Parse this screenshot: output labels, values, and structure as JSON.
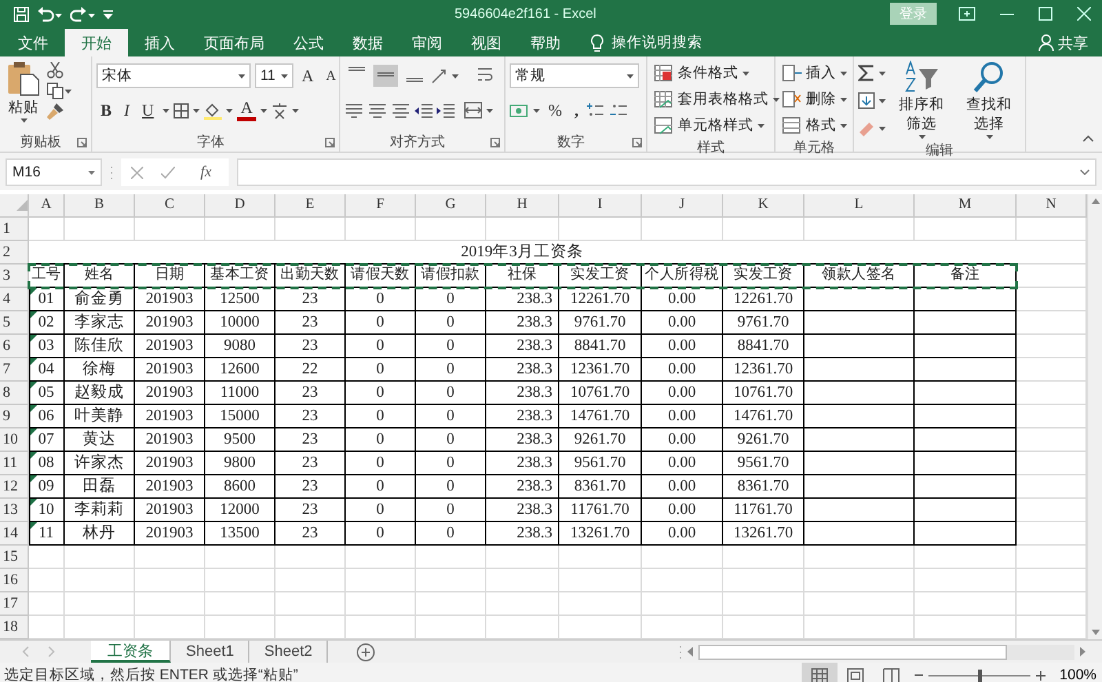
{
  "title_bar": {
    "title": "5946604e2f161  -  Excel",
    "sign_in": "登录"
  },
  "ribbon_tabs": [
    {
      "label": "文件",
      "selected": false
    },
    {
      "label": "开始",
      "selected": true
    },
    {
      "label": "插入",
      "selected": false
    },
    {
      "label": "页面布局",
      "selected": false
    },
    {
      "label": "公式",
      "selected": false
    },
    {
      "label": "数据",
      "selected": false
    },
    {
      "label": "审阅",
      "selected": false
    },
    {
      "label": "视图",
      "selected": false
    },
    {
      "label": "帮助",
      "selected": false
    }
  ],
  "tell_me": "操作说明搜索",
  "share": "共享",
  "ribbon": {
    "clipboard": {
      "paste": "粘贴",
      "label": "剪贴板"
    },
    "font": {
      "font_name": "宋体",
      "font_size": "11",
      "grow": "A",
      "shrink": "A",
      "bold": "B",
      "italic": "I",
      "underline": "U",
      "font_color": "A",
      "label": "字体"
    },
    "alignment": {
      "vertical": [
        {
          "kind": "top",
          "selected": false
        },
        {
          "kind": "middle",
          "selected": true
        },
        {
          "kind": "bottom",
          "selected": false
        }
      ],
      "label": "对齐方式"
    },
    "number": {
      "format": "常规",
      "percent": "%",
      "comma": ",",
      "label": "数字"
    },
    "styles": {
      "items": [
        "条件格式",
        "套用表格格式",
        "单元格样式"
      ],
      "label": "样式"
    },
    "cells": {
      "items": [
        "插入",
        "删除",
        "格式"
      ],
      "label": "单元格"
    },
    "editing": {
      "items": [
        "排序和筛选",
        "查找和选择"
      ],
      "label": "编辑"
    }
  },
  "formula_bar": {
    "name_box": "M16",
    "function_button": "fx"
  },
  "sheet": {
    "columns": [
      "A",
      "B",
      "C",
      "D",
      "E",
      "F",
      "G",
      "H",
      "I",
      "J",
      "K",
      "L",
      "M",
      "N"
    ],
    "row_numbers": [
      "1",
      "2",
      "3",
      "4",
      "5",
      "6",
      "7",
      "8",
      "9",
      "10",
      "11",
      "12",
      "13",
      "14",
      "15",
      "16",
      "17",
      "18"
    ],
    "title": "2019年3月工资条",
    "header": [
      "工号",
      "姓名",
      "日期",
      "基本工资",
      "出勤天数",
      "请假天数",
      "请假扣款",
      "社保",
      "实发工资",
      "个人所得税",
      "实发工资",
      "领款人签名",
      "备注"
    ],
    "header_marquee": true,
    "rows": [
      {
        "cells": [
          "01",
          "俞金勇",
          "201903",
          "12500",
          "23",
          "0",
          "0",
          "238.3",
          "12261.70",
          "0.00",
          "12261.70"
        ],
        "flagged": true
      },
      {
        "cells": [
          "02",
          "李家志",
          "201903",
          "10000",
          "23",
          "0",
          "0",
          "238.3",
          "9761.70",
          "0.00",
          "9761.70"
        ],
        "flagged": true
      },
      {
        "cells": [
          "03",
          "陈佳欣",
          "201903",
          "9080",
          "23",
          "0",
          "0",
          "238.3",
          "8841.70",
          "0.00",
          "8841.70"
        ],
        "flagged": true
      },
      {
        "cells": [
          "04",
          "徐梅",
          "201903",
          "12600",
          "22",
          "0",
          "0",
          "238.3",
          "12361.70",
          "0.00",
          "12361.70"
        ],
        "flagged": true
      },
      {
        "cells": [
          "05",
          "赵毅成",
          "201903",
          "11000",
          "23",
          "0",
          "0",
          "238.3",
          "10761.70",
          "0.00",
          "10761.70"
        ],
        "flagged": true
      },
      {
        "cells": [
          "06",
          "叶美静",
          "201903",
          "15000",
          "23",
          "0",
          "0",
          "238.3",
          "14761.70",
          "0.00",
          "14761.70"
        ],
        "flagged": true
      },
      {
        "cells": [
          "07",
          "黄达",
          "201903",
          "9500",
          "23",
          "0",
          "0",
          "238.3",
          "9261.70",
          "0.00",
          "9261.70"
        ],
        "flagged": true
      },
      {
        "cells": [
          "08",
          "许家杰",
          "201903",
          "9800",
          "23",
          "0",
          "0",
          "238.3",
          "9561.70",
          "0.00",
          "9561.70"
        ],
        "flagged": true
      },
      {
        "cells": [
          "09",
          "田磊",
          "201903",
          "8600",
          "23",
          "0",
          "0",
          "238.3",
          "8361.70",
          "0.00",
          "8361.70"
        ],
        "flagged": true
      },
      {
        "cells": [
          "10",
          "李莉莉",
          "201903",
          "12000",
          "23",
          "0",
          "0",
          "238.3",
          "11761.70",
          "0.00",
          "11761.70"
        ],
        "flagged": true
      },
      {
        "cells": [
          "11",
          "林丹",
          "201903",
          "13500",
          "23",
          "0",
          "0",
          "238.3",
          "13261.70",
          "0.00",
          "13261.70"
        ],
        "flagged": true
      }
    ]
  },
  "sheet_tabs": [
    {
      "label": "工资条",
      "selected": true
    },
    {
      "label": "Sheet1",
      "selected": false
    },
    {
      "label": "Sheet2",
      "selected": false
    }
  ],
  "status_bar": {
    "message": "选定目标区域，然后按 ENTER 或选择“粘贴”",
    "view_buttons": [
      {
        "kind": "normal",
        "selected": true
      },
      {
        "kind": "page_layout",
        "selected": false
      },
      {
        "kind": "page_break",
        "selected": false
      }
    ],
    "zoom_slider": {
      "level": 0.5
    },
    "zoom": "100%"
  }
}
